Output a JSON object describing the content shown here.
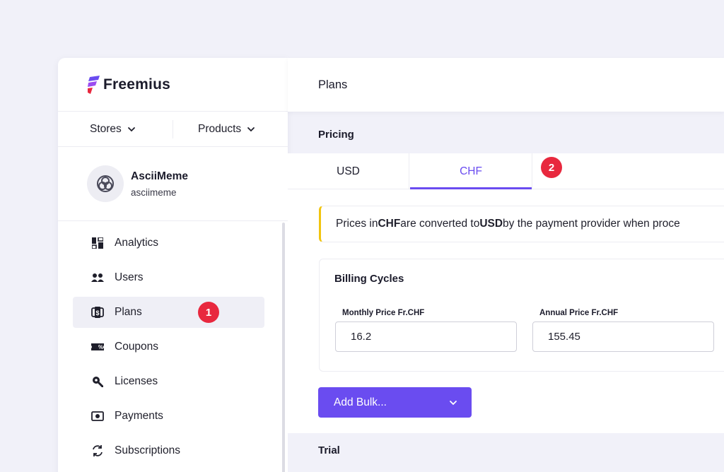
{
  "brand": {
    "name": "Freemius",
    "accent": "#6a4cf0",
    "badge_color": "#e8283e"
  },
  "topnav": {
    "stores_label": "Stores",
    "products_label": "Products"
  },
  "product": {
    "name": "AsciiMeme",
    "slug": "asciimeme",
    "icon": "product-logo-icon"
  },
  "menu": {
    "items": [
      {
        "label": "Analytics",
        "icon": "analytics-icon"
      },
      {
        "label": "Users",
        "icon": "users-icon"
      },
      {
        "label": "Plans",
        "icon": "plans-icon",
        "active": true
      },
      {
        "label": "Coupons",
        "icon": "coupons-icon"
      },
      {
        "label": "Licenses",
        "icon": "key-icon"
      },
      {
        "label": "Payments",
        "icon": "payments-icon"
      },
      {
        "label": "Subscriptions",
        "icon": "subscriptions-icon"
      }
    ]
  },
  "badges": {
    "one": "1",
    "two": "2"
  },
  "header": {
    "title": "Plans"
  },
  "pricing": {
    "section_label": "Pricing",
    "tabs": [
      {
        "label": "USD"
      },
      {
        "label": "CHF",
        "active": true
      }
    ],
    "notice": {
      "pre": "Prices in ",
      "from": "CHF",
      "mid": " are converted to ",
      "to": "USD",
      "post": " by the payment provider when proce"
    }
  },
  "billing": {
    "title": "Billing Cycles",
    "monthly_label": "Monthly Price Fr.CHF",
    "monthly_value": "16.2",
    "annual_label": "Annual Price Fr.CHF",
    "annual_value": "155.45"
  },
  "actions": {
    "add_bulk_label": "Add Bulk..."
  },
  "trial": {
    "section_label": "Trial"
  }
}
